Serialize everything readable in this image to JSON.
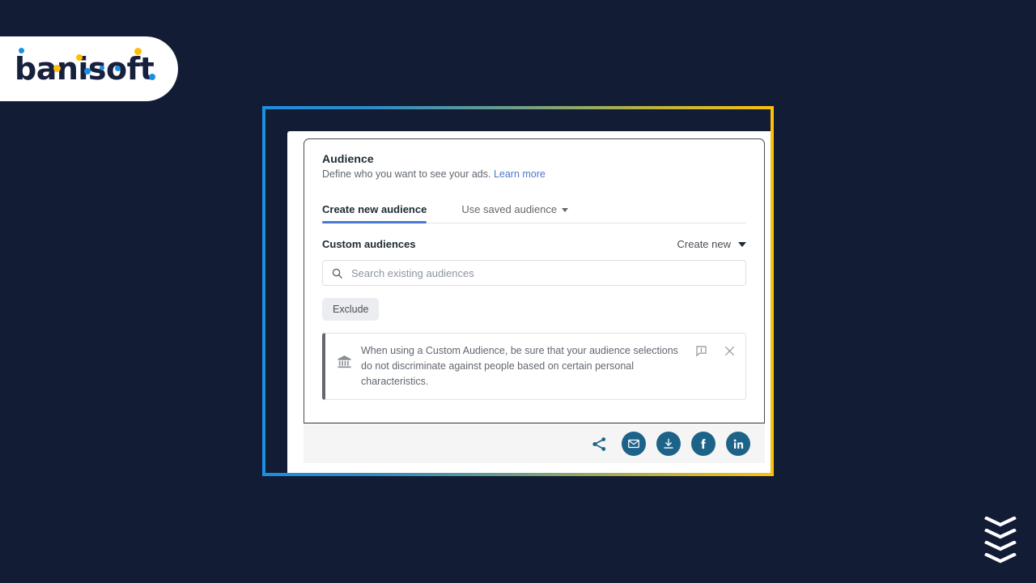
{
  "page": {
    "background_color": "#121c35"
  },
  "brand": {
    "name": "banisoft",
    "accent_blue": "#1a8fe3",
    "accent_yellow": "#fbbf08",
    "text_color": "#17203d"
  },
  "frame": {
    "gradient_from": "#1b8fe0",
    "gradient_to": "#fcc00a"
  },
  "card": {
    "title": "Audience",
    "subtitle": "Define who you want to see your ads.",
    "learn_more": "Learn more",
    "tabs": [
      {
        "label": "Create new audience",
        "active": true,
        "has_caret": false
      },
      {
        "label": "Use saved audience",
        "active": false,
        "has_caret": true
      }
    ],
    "custom_audiences": {
      "label": "Custom audiences",
      "create_new_label": "Create new"
    },
    "search": {
      "placeholder": "Search existing audiences",
      "value": "",
      "icon": "search-icon"
    },
    "exclude_button": "Exclude",
    "notice": {
      "icon": "bank-building-icon",
      "text": "When using a Custom Audience, be sure that your audience selections do not discriminate against people based on certain personal characteristics.",
      "feedback_icon": "feedback-alert-icon",
      "close_icon": "close-icon",
      "accent_color": "#65686e"
    }
  },
  "social_bar": {
    "background": "#f5f5f5",
    "button_color": "#1d6389",
    "items": [
      {
        "name": "share-icon",
        "label": "Share",
        "filled": false
      },
      {
        "name": "email-icon",
        "label": "Email",
        "filled": true
      },
      {
        "name": "download-icon",
        "label": "Download",
        "filled": true
      },
      {
        "name": "facebook-icon",
        "label": "Facebook",
        "filled": true
      },
      {
        "name": "linkedin-icon",
        "label": "LinkedIn",
        "filled": true
      }
    ]
  },
  "scroll_indicator": {
    "name": "chevron-down-icon",
    "count": 4,
    "color": "#ffffff"
  }
}
